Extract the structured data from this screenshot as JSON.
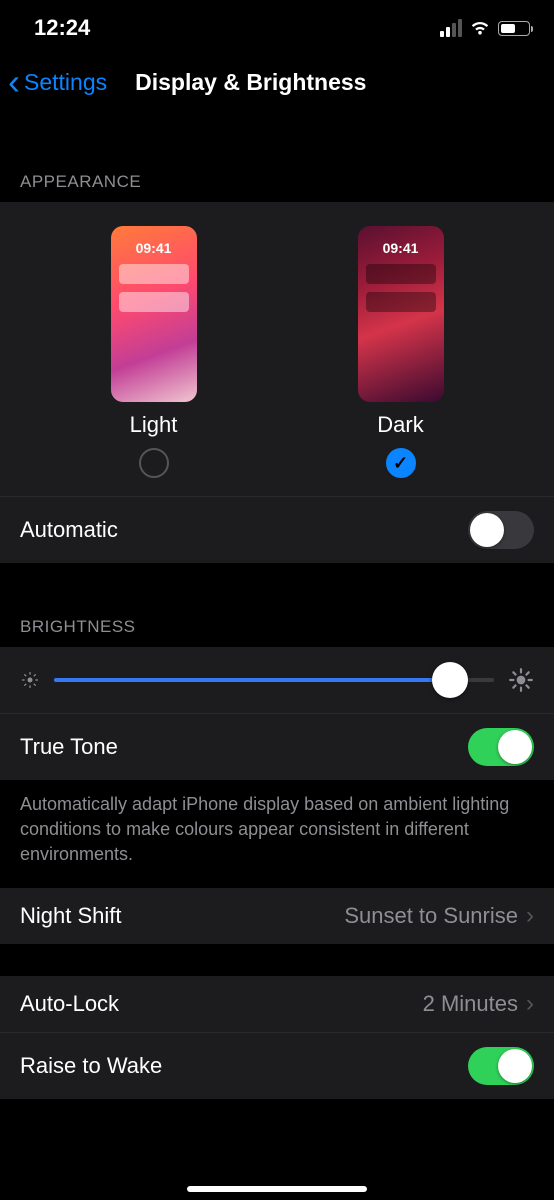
{
  "status": {
    "time": "12:24"
  },
  "nav": {
    "back": "Settings",
    "title": "Display & Brightness"
  },
  "appearance": {
    "header": "Appearance",
    "preview_time": "09:41",
    "light_label": "Light",
    "dark_label": "Dark",
    "selected": "dark",
    "automatic_label": "Automatic",
    "automatic_on": false
  },
  "brightness": {
    "header": "Brightness",
    "value_percent": 90,
    "true_tone_label": "True Tone",
    "true_tone_on": true,
    "true_tone_footer": "Automatically adapt iPhone display based on ambient lighting conditions to make colours appear consistent in different environments."
  },
  "night_shift": {
    "label": "Night Shift",
    "value": "Sunset to Sunrise"
  },
  "auto_lock": {
    "label": "Auto-Lock",
    "value": "2 Minutes"
  },
  "raise_to_wake": {
    "label": "Raise to Wake",
    "on": true
  }
}
